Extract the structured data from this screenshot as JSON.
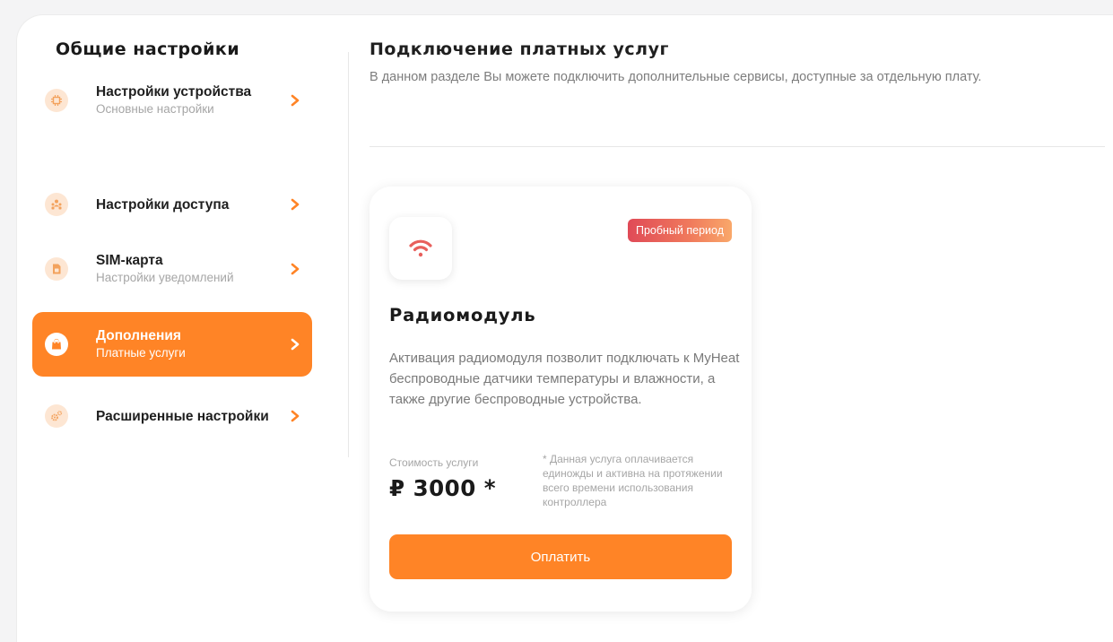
{
  "sidebar": {
    "title": "Общие настройки",
    "items": [
      {
        "label": "Настройки устройства",
        "sub": "Основные настройки",
        "icon": "chip-icon",
        "active": false
      },
      {
        "label": "Настройки доступа",
        "sub": "",
        "icon": "users-icon",
        "active": false
      },
      {
        "label": "SIM-карта",
        "sub": "Настройки уведомлений",
        "icon": "sim-card-icon",
        "active": false
      },
      {
        "label": "Дополнения",
        "sub": "Платные услуги",
        "icon": "shopping-bag-icon",
        "active": true
      },
      {
        "label": "Расширенные настройки",
        "sub": "",
        "icon": "gears-icon",
        "active": false
      }
    ]
  },
  "main": {
    "title": "Подключение платных услуг",
    "description": "В данном разделе Вы можете подключить дополнительные сервисы, доступные за отдельную плату."
  },
  "card": {
    "icon": "wifi-icon",
    "badge": "Пробный период",
    "title": "Радиомодуль",
    "description": "Активация радиомодуля позволит подключать к MyHeat беспроводные датчики температуры и влажности, а также другие беспроводные устройства.",
    "price_label": "Стоимость услуги",
    "price": "₽ 3000 *",
    "price_note": "* Данная услуга оплачивается единожды и активна на протяжении всего времени использования контроллера",
    "pay_label": "Оплатить"
  },
  "colors": {
    "accent": "#ff8426",
    "icon_bg": "#fde6d3",
    "wifi": "#e8605c",
    "badge_start": "#e04a57",
    "badge_end": "#f9a86a"
  }
}
